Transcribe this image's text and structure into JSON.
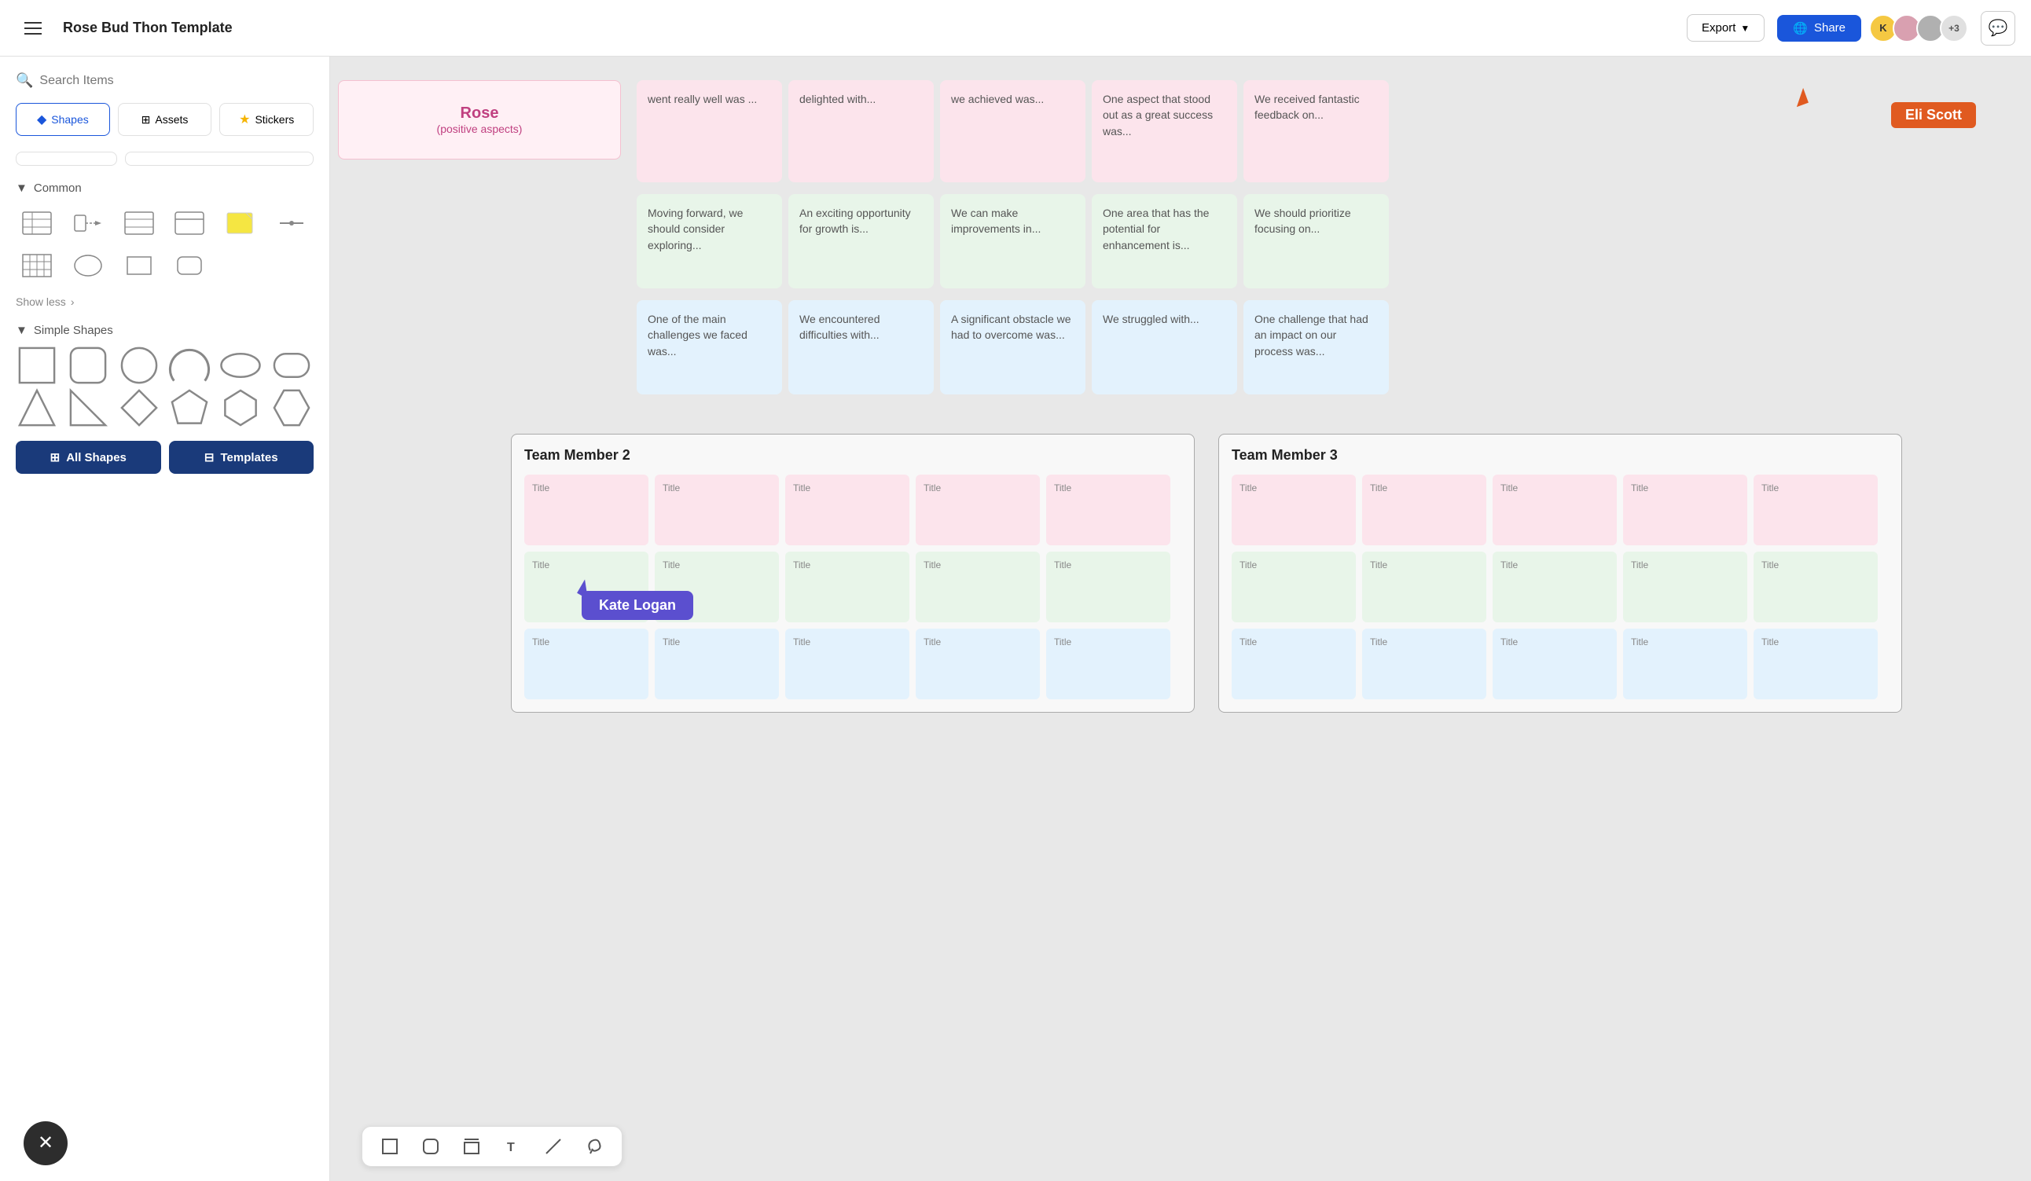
{
  "topbar": {
    "menu_label": "Menu",
    "title": "Rose Bud Thon Template",
    "export_label": "Export",
    "share_label": "Share",
    "avatars": [
      {
        "initials": "K",
        "color": "yellow"
      },
      {
        "color": "pink"
      },
      {
        "color": "gray"
      },
      {
        "label": "+3"
      }
    ]
  },
  "sidebar": {
    "search_placeholder": "Search Items",
    "tabs": [
      {
        "label": "Shapes",
        "active": true
      },
      {
        "label": "Assets",
        "active": false
      },
      {
        "label": "Stickers",
        "active": false
      }
    ],
    "common_label": "Common",
    "show_less_label": "Show less",
    "simple_shapes_label": "Simple Shapes",
    "all_shapes_label": "All Shapes",
    "templates_label": "Templates"
  },
  "canvas": {
    "rose_label": "Rose",
    "rose_sub": "(positive aspects)",
    "rows": [
      [
        {
          "text": "went really well was ...",
          "color": "pink"
        },
        {
          "text": "delighted with...",
          "color": "pink"
        },
        {
          "text": "we achieved was...",
          "color": "pink"
        },
        {
          "text": "One aspect that stood out as a great success was...",
          "color": "pink"
        },
        {
          "text": "We received fantastic feedback on...",
          "color": "pink"
        }
      ],
      [
        {
          "text": "Moving forward, we should consider exploring...",
          "color": "green"
        },
        {
          "text": "An exciting opportunity for growth is...",
          "color": "green"
        },
        {
          "text": "We can make improvements in...",
          "color": "green"
        },
        {
          "text": "One area that has the potential for enhancement is...",
          "color": "green"
        },
        {
          "text": "We should prioritize focusing on...",
          "color": "green"
        }
      ],
      [
        {
          "text": "One of the main challenges we faced was...",
          "color": "blue"
        },
        {
          "text": "We encountered difficulties with...",
          "color": "blue"
        },
        {
          "text": "A significant obstacle we had to overcome was...",
          "color": "blue"
        },
        {
          "text": "We struggled with...",
          "color": "blue"
        },
        {
          "text": "One challenge that had an impact on our process was...",
          "color": "blue"
        }
      ]
    ],
    "team2_label": "Team Member 2",
    "team3_label": "Team Member 3",
    "card_title": "Title",
    "team_rows": [
      [
        "Title",
        "Title",
        "Title",
        "Title",
        "Title"
      ],
      [
        "Title",
        "Title",
        "Title",
        "Title",
        "Title"
      ],
      [
        "Title",
        "Title",
        "Title",
        "Title",
        "Title"
      ]
    ]
  },
  "cursors": {
    "eli": {
      "label": "Eli Scott",
      "color": "#e05a20"
    },
    "kate": {
      "label": "Kate Logan",
      "color": "#5b4fcf"
    }
  },
  "toolbar": {
    "items": [
      "rectangle",
      "rounded-rectangle",
      "shape-container",
      "text",
      "line",
      "lasso"
    ]
  }
}
